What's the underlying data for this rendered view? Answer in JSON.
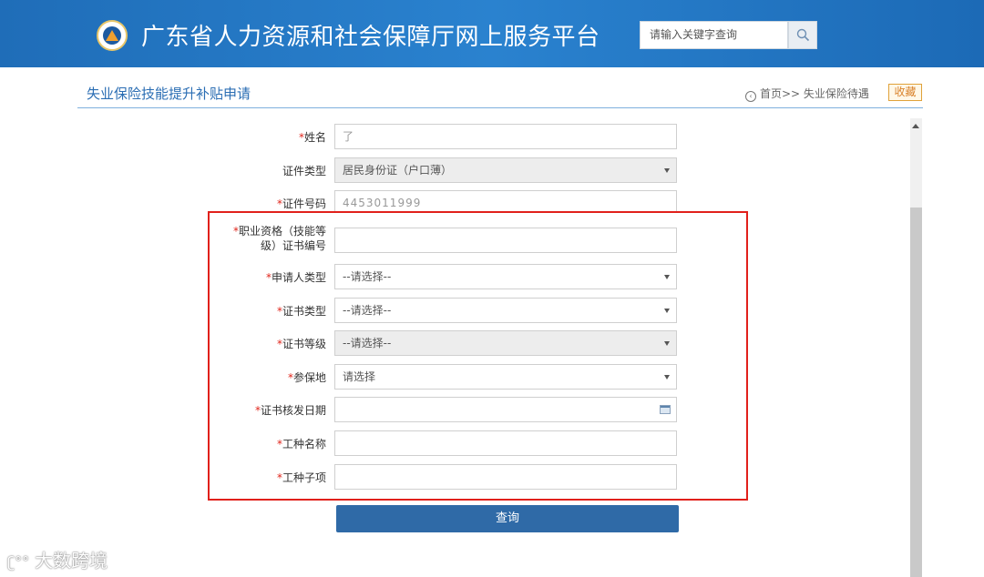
{
  "header": {
    "site_title": "广东省人力资源和社会保障厅网上服务平台",
    "search_placeholder": "请输入关键字查询",
    "search_icon": "search-icon",
    "logo_icon": "hrss-emblem"
  },
  "page": {
    "title": "失业保险技能提升补贴申请",
    "breadcrumb": "首页>> 失业保险待遇",
    "favorite_label": "收藏"
  },
  "form": {
    "required_mark": "*",
    "fields": [
      {
        "label": "姓名",
        "required": true,
        "type": "text",
        "value": "了",
        "masked": true
      },
      {
        "label": "证件类型",
        "required": false,
        "type": "select",
        "value": "居民身份证（户口薄）",
        "disabled": true
      },
      {
        "label": "证件号码",
        "required": true,
        "type": "text",
        "value": "4453011999",
        "masked": true
      },
      {
        "label_line1": "职业资格（技能等",
        "label_line2": "级）证书编号",
        "required": true,
        "type": "text",
        "value": ""
      },
      {
        "label": "申请人类型",
        "required": true,
        "type": "select",
        "value": "--请选择--"
      },
      {
        "label": "证书类型",
        "required": true,
        "type": "select",
        "value": "--请选择--"
      },
      {
        "label": "证书等级",
        "required": true,
        "type": "select",
        "value": "--请选择--",
        "disabled": true
      },
      {
        "label": "参保地",
        "required": true,
        "type": "select",
        "value": "请选择"
      },
      {
        "label": "证书核发日期",
        "required": true,
        "type": "date",
        "value": ""
      },
      {
        "label": "工种名称",
        "required": true,
        "type": "text",
        "value": ""
      },
      {
        "label": "工种子项",
        "required": true,
        "type": "text",
        "value": ""
      }
    ],
    "submit_label": "查询"
  },
  "watermark": "大数跨境",
  "colors": {
    "header_blue": "#2a82cf",
    "title_blue": "#2a6db3",
    "required_red": "#e0251b",
    "highlight_red": "#e1201b",
    "button_blue": "#2f6aa7",
    "favorite_orange": "#d9822b"
  }
}
